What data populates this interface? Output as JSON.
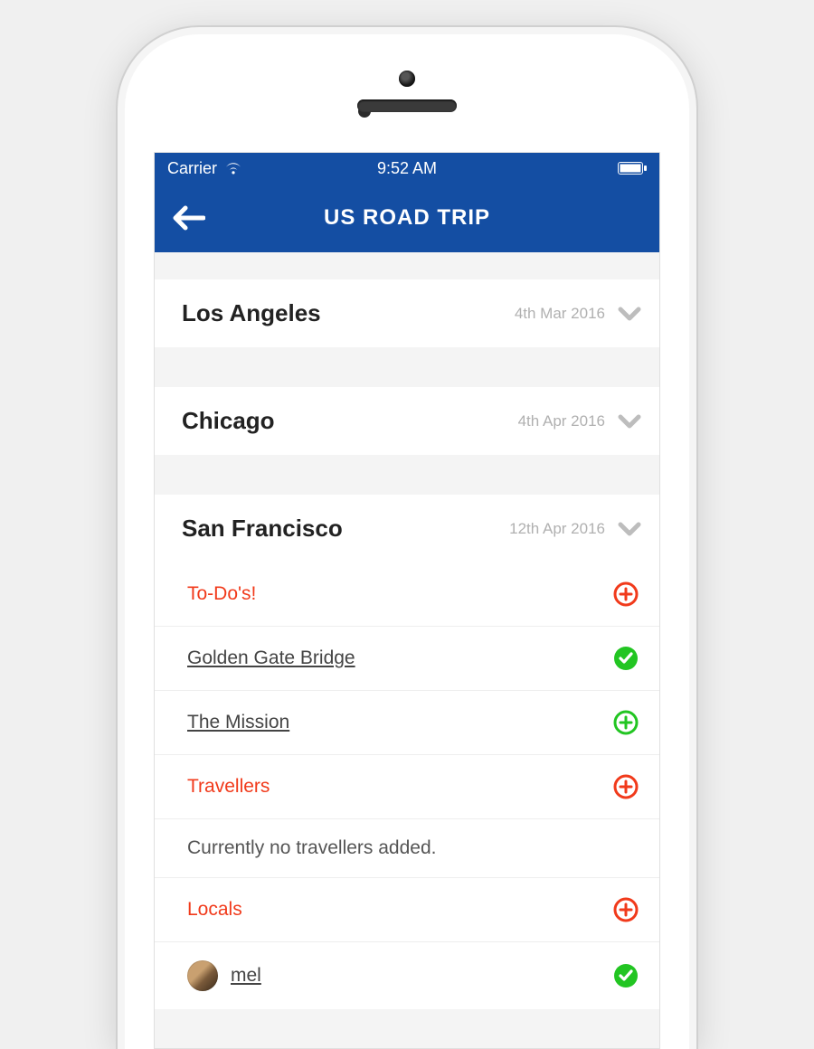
{
  "status": {
    "carrier": "Carrier",
    "time": "9:52 AM"
  },
  "nav": {
    "title": "US ROAD TRIP"
  },
  "cities": [
    {
      "name": "Los Angeles",
      "date": "4th Mar 2016"
    },
    {
      "name": "Chicago",
      "date": "4th Apr 2016"
    },
    {
      "name": "San Francisco",
      "date": "12th Apr 2016"
    }
  ],
  "expanded": {
    "todos_header": "To-Do's!",
    "todo_items": [
      {
        "label": "Golden Gate Bridge",
        "status": "done"
      },
      {
        "label": "The Mission",
        "status": "open"
      }
    ],
    "travellers_header": "Travellers",
    "travellers_empty": "Currently no travellers added.",
    "locals_header": "Locals",
    "locals": [
      {
        "name": "mel"
      }
    ]
  }
}
